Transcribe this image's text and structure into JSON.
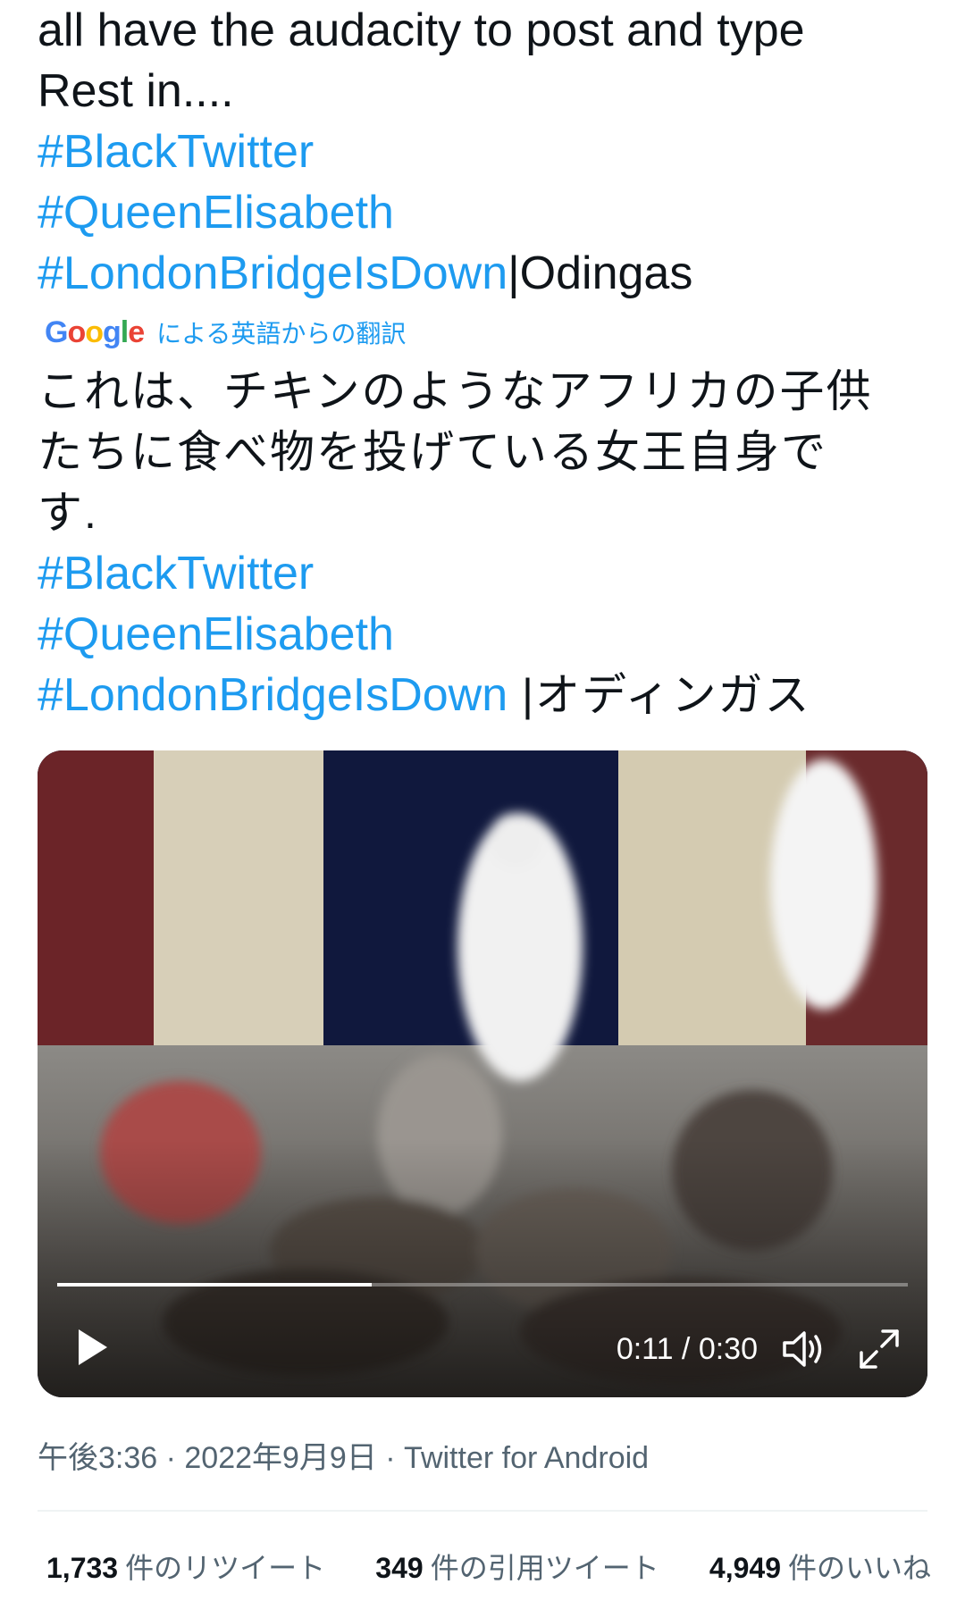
{
  "tweet": {
    "text_lines": [
      "all have the audacity to post and type",
      "Rest in...."
    ],
    "hashtags": [
      "#BlackTwitter",
      "#QueenElisabeth",
      "#LondonBridgeIsDown"
    ],
    "suffix": "|Odingas"
  },
  "translation": {
    "logo_text": "Google",
    "label": "による英語からの翻訳",
    "text_lines": [
      "これは、チキンのようなアフリカの子供",
      "たちに食べ物を投げている女王自身で",
      "す."
    ],
    "hashtags": [
      "#BlackTwitter",
      "#QueenElisabeth",
      "#LondonBridgeIsDown"
    ],
    "suffix": " |オディンガス"
  },
  "video": {
    "current_time": "0:11",
    "duration": "0:30",
    "time_display": "0:11 / 0:30",
    "progress": 0.37,
    "play_icon": "play-icon",
    "volume_icon": "volume-icon",
    "fullscreen_icon": "fullscreen-icon"
  },
  "meta": {
    "text": "午後3:36 · 2022年9月9日 · Twitter for Android"
  },
  "stats": {
    "retweets_count": "1,733",
    "retweets_label": "件のリツイート",
    "quotes_count": "349",
    "quotes_label": "件の引用ツイート",
    "likes_count": "4,949",
    "likes_label": "件のいいね"
  },
  "colors": {
    "link": "#1d9bf0",
    "text": "#0f1419",
    "muted": "#536471"
  }
}
